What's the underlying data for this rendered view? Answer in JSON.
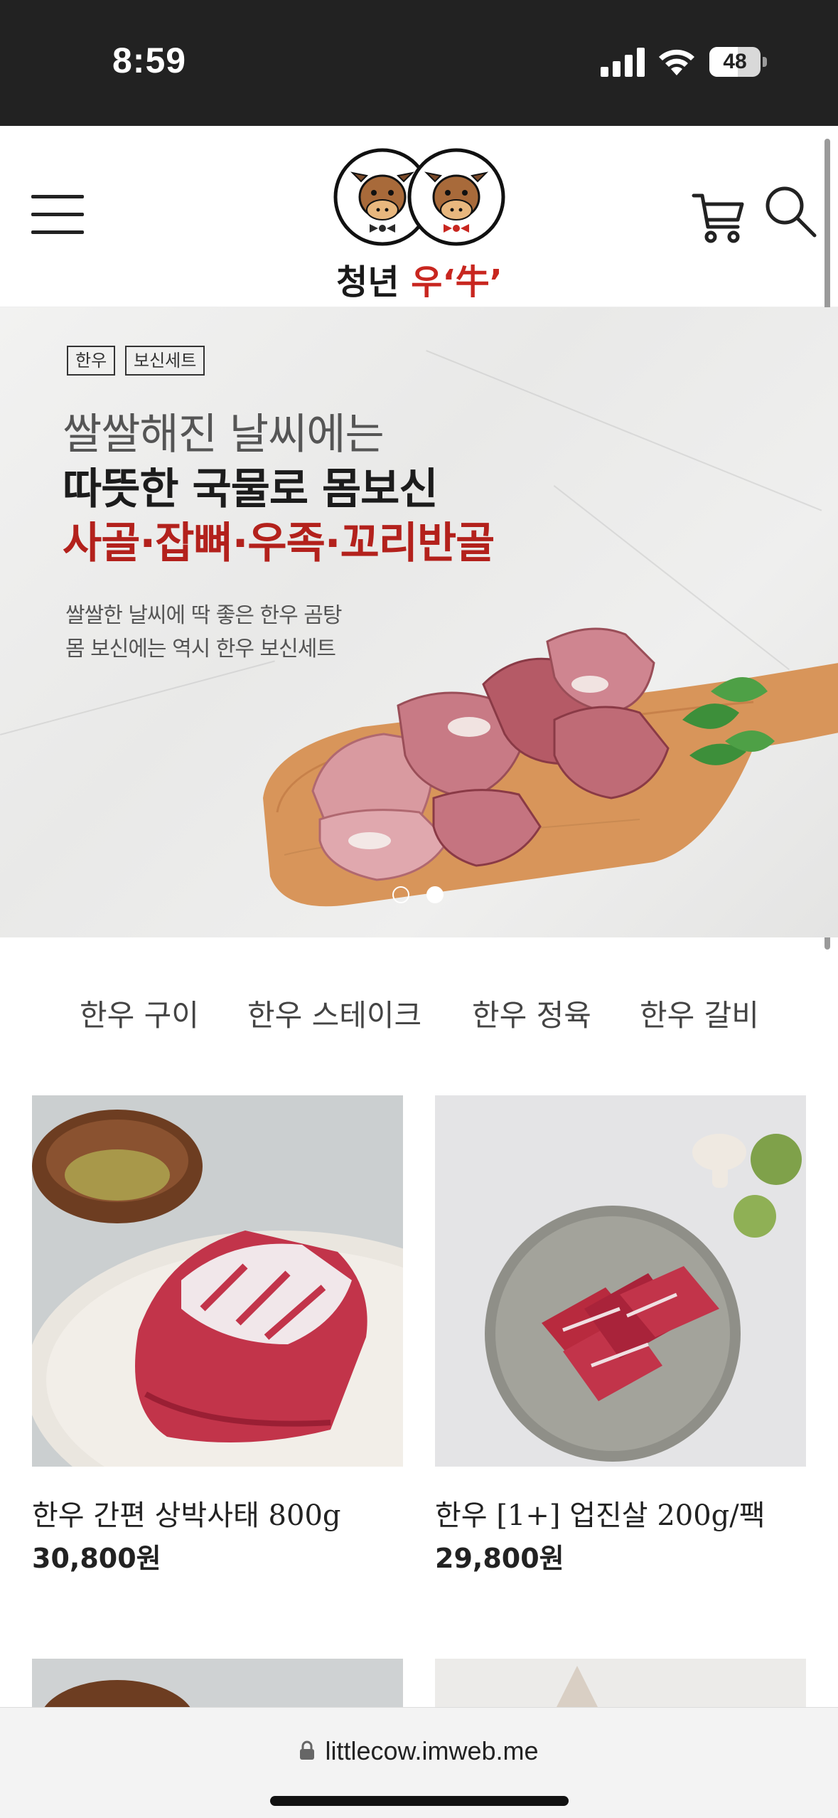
{
  "status": {
    "time": "8:59",
    "battery": "48"
  },
  "header": {
    "logo_text_black": "청년 ",
    "logo_text_red": "우‘牛’",
    "icons": [
      "menu-icon",
      "cart-icon",
      "search-icon"
    ]
  },
  "banner": {
    "tags": [
      "한우",
      "보신세트"
    ],
    "line1": "쌀쌀해진 날씨에는",
    "line2": "따뜻한 국물로 몸보신",
    "line3": "사골·잡뼈·우족·꼬리반골",
    "sub1": "쌀쌀한 날씨에 딱 좋은 한우 곰탕",
    "sub2": "몸 보신에는 역시 한우 보신세트",
    "slide_count": 2,
    "active_slide": 2,
    "accent_color": "#b3211c"
  },
  "tabs": [
    "한우 구이",
    "한우 스테이크",
    "한우 정육",
    "한우 갈비"
  ],
  "products": [
    {
      "name": "한우 간편 상박사태 800g",
      "price": "30,800원"
    },
    {
      "name": "한우 [1+] 업진살 200g/팩",
      "price": "29,800원"
    }
  ],
  "browser": {
    "url": "littlecow.imweb.me"
  }
}
